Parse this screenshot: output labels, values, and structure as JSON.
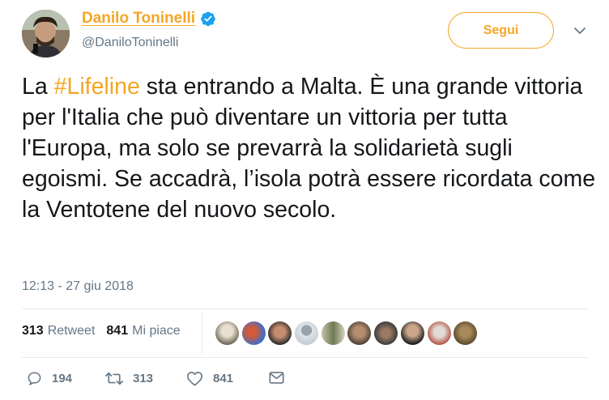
{
  "author": {
    "display_name": "Danilo Toninelli",
    "handle": "@DaniloToninelli"
  },
  "follow_button": {
    "label": "Segui"
  },
  "tweet": {
    "text_before_hashtag": "La ",
    "hashtag": "#Lifeline",
    "text_after_hashtag": " sta entrando a Malta. È una grande vittoria per l'Italia che può diventare un vittoria per tutta l'Europa, ma solo se prevarrà la solidarietà sugli egoismi. Se accadrà, l’isola potrà essere ricordata come la Ventotene del nuovo secolo.",
    "timestamp": "12:13 - 27 giu 2018"
  },
  "stats": {
    "retweets": {
      "count": "313",
      "label": "Retweet"
    },
    "likes": {
      "count": "841",
      "label": "Mi piace"
    }
  },
  "actions": {
    "replies": "194",
    "retweets": "313",
    "likes": "841"
  },
  "colors": {
    "accent": "#f5a623",
    "verified": "#1da1f2",
    "muted_text": "#657786"
  },
  "icons": [
    "verified-badge-icon",
    "chevron-down-icon",
    "reply-icon",
    "retweet-icon",
    "like-icon",
    "message-icon"
  ]
}
